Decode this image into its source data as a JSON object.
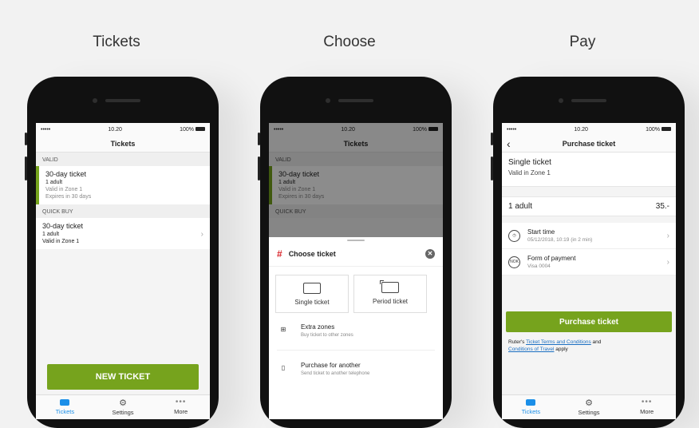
{
  "columns": {
    "tickets_title": "Tickets",
    "choose_title": "Choose",
    "pay_title": "Pay"
  },
  "status": {
    "time": "10.20",
    "battery": "100%",
    "signal": "•••••"
  },
  "tabs": {
    "tickets": "Tickets",
    "settings": "Settings",
    "more": "More"
  },
  "screen1": {
    "nav_title": "Tickets",
    "valid_header": "VALID",
    "valid_ticket": {
      "name": "30-day ticket",
      "people": "1 adult",
      "zone": "Valid in Zone 1",
      "expires": "Expires in 30 days"
    },
    "quick_header": "QUICK BUY",
    "quick_ticket": {
      "name": "30-day ticket",
      "people": "1 adult",
      "zone": "Valid in Zone 1"
    },
    "new_ticket_button": "NEW TICKET"
  },
  "screen2": {
    "nav_title": "Tickets",
    "valid_header": "VALID",
    "valid_ticket": {
      "name": "30-day ticket",
      "people": "1 adult",
      "zone": "Valid in Zone 1",
      "expires": "Expires in 30 days"
    },
    "quick_header": "QUICK BUY",
    "sheet_title": "Choose ticket",
    "single_ticket": "Single ticket",
    "period_ticket": "Period ticket",
    "extra_zones": {
      "title": "Extra zones",
      "subtitle": "Buy ticket to other zones"
    },
    "purchase_another": {
      "title": "Purchase for another",
      "subtitle": "Send ticket to another telephone"
    }
  },
  "screen3": {
    "nav_title": "Purchase ticket",
    "ticket_name": "Single ticket",
    "ticket_zone": "Valid in Zone 1",
    "adult_label": "1 adult",
    "adult_price": "35.-",
    "start_time_label": "Start time",
    "start_time_value": "05/12/2018, 10:19 (in 2 min)",
    "payment_label": "Form of payment",
    "payment_value": "Visa 0004",
    "nok_badge": "NOK",
    "purchase_button": "Purchase ticket",
    "terms_prefix": "Ruter's ",
    "terms_link1": "Ticket Terms and Conditions",
    "terms_mid": " and",
    "terms_link2": "Conditions of Travel",
    "terms_suffix": " apply"
  },
  "colors": {
    "green": "#76a31d",
    "blue": "#1b8fe8",
    "red": "#d9262c"
  },
  "icons": [
    "back-chevron-icon",
    "chevron-right-icon",
    "ticket-icon",
    "gear-icon",
    "more-dots-icon",
    "close-icon",
    "single-ticket-icon",
    "period-ticket-icon",
    "extra-zones-icon",
    "phone-icon",
    "clock-icon",
    "nok-icon"
  ]
}
